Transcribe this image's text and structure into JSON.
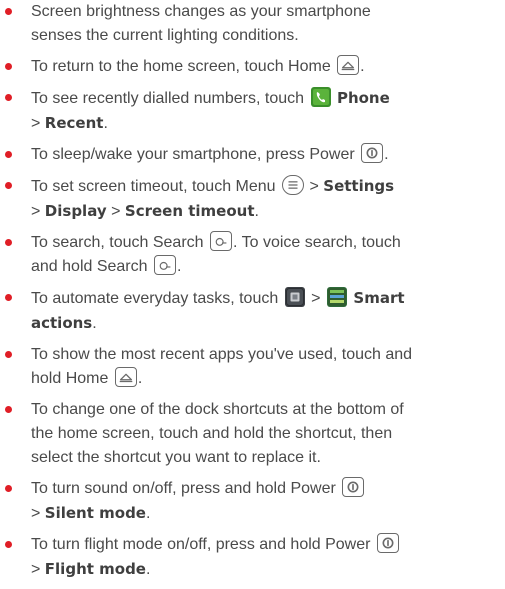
{
  "accent_color": "#e01e26",
  "tips": [
    {
      "line1": "Screen brightness changes as your smartphone",
      "line2": "senses the current lighting conditions."
    },
    {
      "pre": "To return to the home screen, touch Home",
      "icon": "home-key-icon",
      "post": "."
    },
    {
      "pre": "To see recently dialled numbers, touch",
      "icon": "phone-app-icon",
      "bold1": "Phone",
      "sep": ">",
      "bold2": "Recent",
      "post": "."
    },
    {
      "pre": "To sleep/wake your smartphone, press Power",
      "icon": "power-key-icon",
      "post": "."
    },
    {
      "pre": "To set screen timeout, touch Menu",
      "icon": "menu-key-icon",
      "sep": ">",
      "bold1": "Settings",
      "bold2": "Display",
      "bold3": "Screen timeout",
      "post": "."
    },
    {
      "pre": "To search, touch Search",
      "icon": "search-key-icon",
      "mid": ". To voice search, touch",
      "line2pre": "and hold Search",
      "post": "."
    },
    {
      "pre": "To automate everyday tasks, touch",
      "icon1": "app-tray-icon",
      "sep": ">",
      "icon2": "smart-actions-icon",
      "bold1": "Smart",
      "bold2": "actions",
      "post": "."
    },
    {
      "line1": "To show the most recent apps you've used, touch and",
      "line2pre": "hold Home",
      "icon": "home-key-icon",
      "post": "."
    },
    {
      "line1": "To change one of the dock shortcuts at the bottom of",
      "line2": "the home screen, touch and hold the shortcut, then",
      "line3": "select the shortcut you want to replace it."
    },
    {
      "pre": "To turn sound on/off, press and hold Power",
      "icon": "power-key-icon",
      "sep": ">",
      "bold1": "Silent mode",
      "post": "."
    },
    {
      "pre": "To turn flight mode on/off, press and hold Power",
      "icon": "power-key-icon",
      "sep": ">",
      "bold1": "Flight mode",
      "post": "."
    }
  ]
}
